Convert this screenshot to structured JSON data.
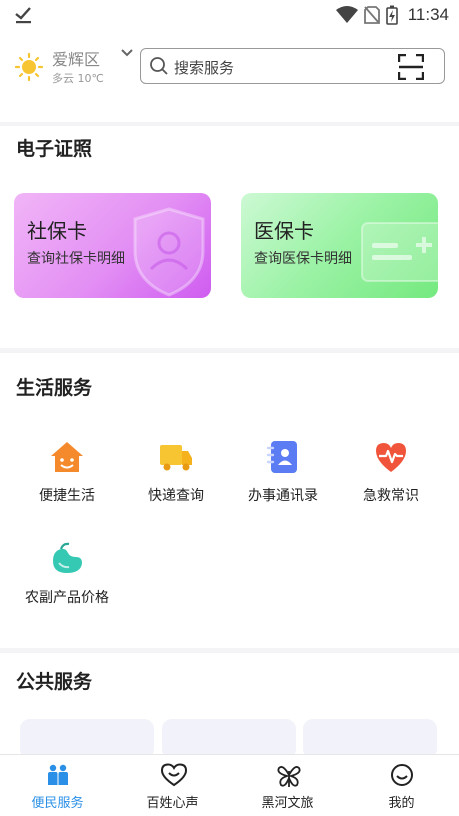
{
  "status_bar": {
    "time": "11:34",
    "icons": [
      "check-icon",
      "wifi-icon",
      "no-sim-icon",
      "battery-charging-icon"
    ]
  },
  "header": {
    "weather": {
      "district": "爱辉区",
      "forecast": "多云 10℃",
      "icon": "sun-icon"
    },
    "search": {
      "placeholder": "搜索服务"
    }
  },
  "certificates": {
    "title": "电子证照",
    "cards": [
      {
        "title": "社保卡",
        "subtitle": "查询社保卡明细"
      },
      {
        "title": "医保卡",
        "subtitle": "查询医保卡明细"
      }
    ]
  },
  "life_services": {
    "title": "生活服务",
    "items": [
      {
        "label": "便捷生活",
        "icon": "house-smile-icon"
      },
      {
        "label": "快递查询",
        "icon": "truck-icon"
      },
      {
        "label": "办事通讯录",
        "icon": "contacts-book-icon"
      },
      {
        "label": "急救常识",
        "icon": "heart-pulse-icon"
      },
      {
        "label": "农副产品价格",
        "icon": "bean-icon"
      }
    ]
  },
  "public_services": {
    "title": "公共服务"
  },
  "bottom_nav": {
    "items": [
      {
        "label": "便民服务",
        "icon": "people-icon",
        "active": true
      },
      {
        "label": "百姓心声",
        "icon": "heart-face-icon",
        "active": false
      },
      {
        "label": "黑河文旅",
        "icon": "butterfly-icon",
        "active": false
      },
      {
        "label": "我的",
        "icon": "smiley-icon",
        "active": false
      }
    ]
  },
  "colors": {
    "accent": "#2a8fe6",
    "social_card": "#e38ff4",
    "medical_card": "#8ef098"
  }
}
